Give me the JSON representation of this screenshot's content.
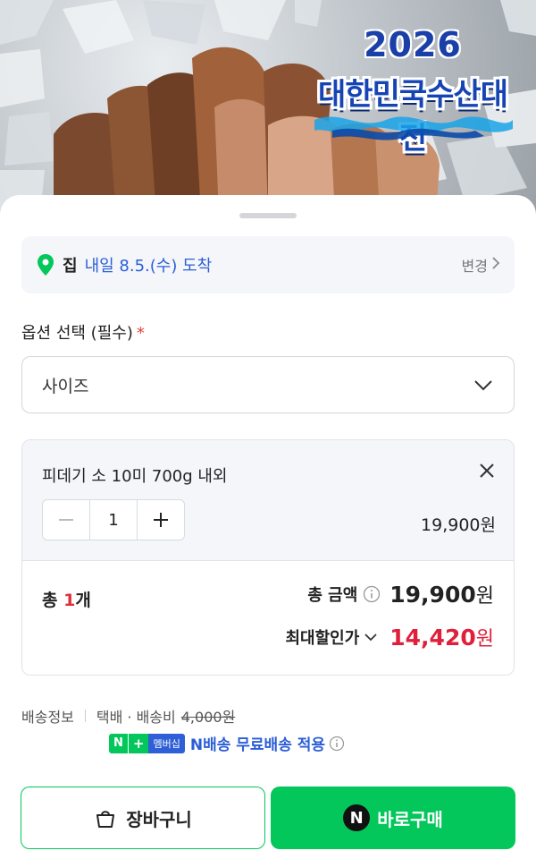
{
  "banner": {
    "year": "2026",
    "title": "대한민국수산대전"
  },
  "delivery": {
    "place": "집",
    "date": "내일 8.5.(수) 도착",
    "change_label": "변경"
  },
  "options": {
    "label": "옵션 선택 (필수)",
    "required_mark": "*",
    "select_value": "사이즈"
  },
  "selected_item": {
    "name": "피데기 소 10미 700g 내외",
    "quantity": "1",
    "price": "19,900원"
  },
  "summary": {
    "count_prefix": "총 ",
    "count_num": "1",
    "count_suffix": "개",
    "total_label": "총 금액",
    "total_amount": "19,900",
    "total_unit": "원",
    "discount_label": "최대할인가",
    "discount_amount": "14,420",
    "discount_unit": "원"
  },
  "shipping": {
    "title": "배송정보",
    "method": "택배 · 배송비",
    "old_fee": "4,000원",
    "badge_n": "N",
    "badge_plus": "+",
    "badge_member": "멤버십",
    "member_text": "N배송 무료배송 적용"
  },
  "buttons": {
    "cart": "장바구니",
    "buy": "바로구매",
    "npay_glyph": "N"
  },
  "colors": {
    "accent_green": "#03c75a",
    "link_blue": "#2b5ed6",
    "discount_red": "#e01f3a"
  }
}
